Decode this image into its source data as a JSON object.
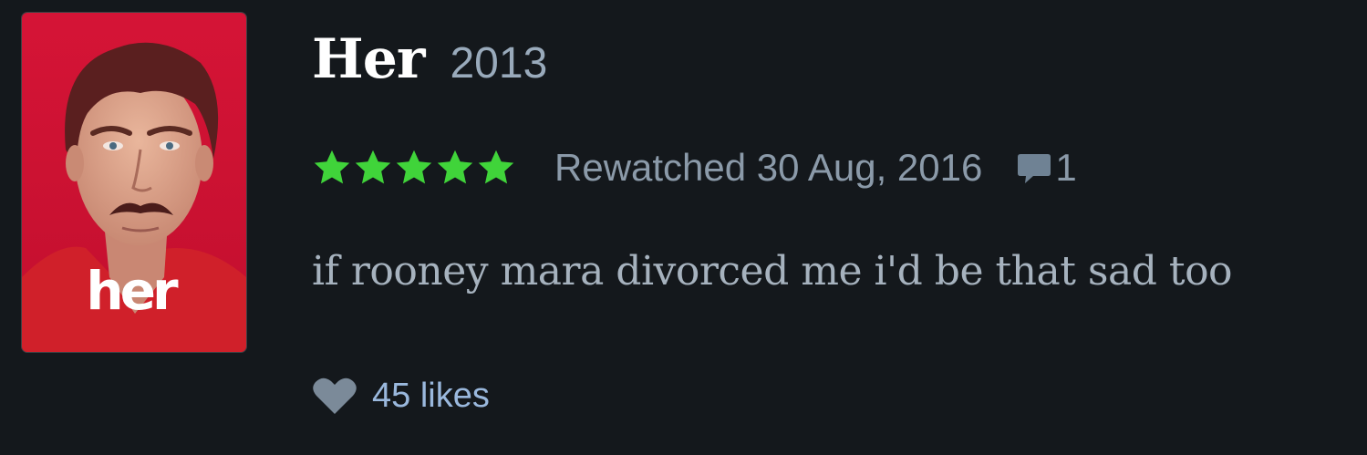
{
  "film": {
    "title": "Her",
    "year": "2013",
    "poster_text": "her"
  },
  "review": {
    "rating_stars": 5,
    "rating_max": 5,
    "watch_status": "Rewatched 30 Aug, 2016",
    "comment_count": "1",
    "text": "if rooney mara divorced me i'd be that sad too",
    "likes": "45 likes"
  },
  "icons": {
    "star": "star-icon",
    "comment": "speech-bubble-icon",
    "like": "heart-icon"
  },
  "colors": {
    "background": "#14181c",
    "star": "#40d43a",
    "muted_text": "#8b9aa9",
    "review_text": "#a6b2be",
    "likes_text": "#9ab8dd",
    "poster_red": "#d8183a"
  }
}
